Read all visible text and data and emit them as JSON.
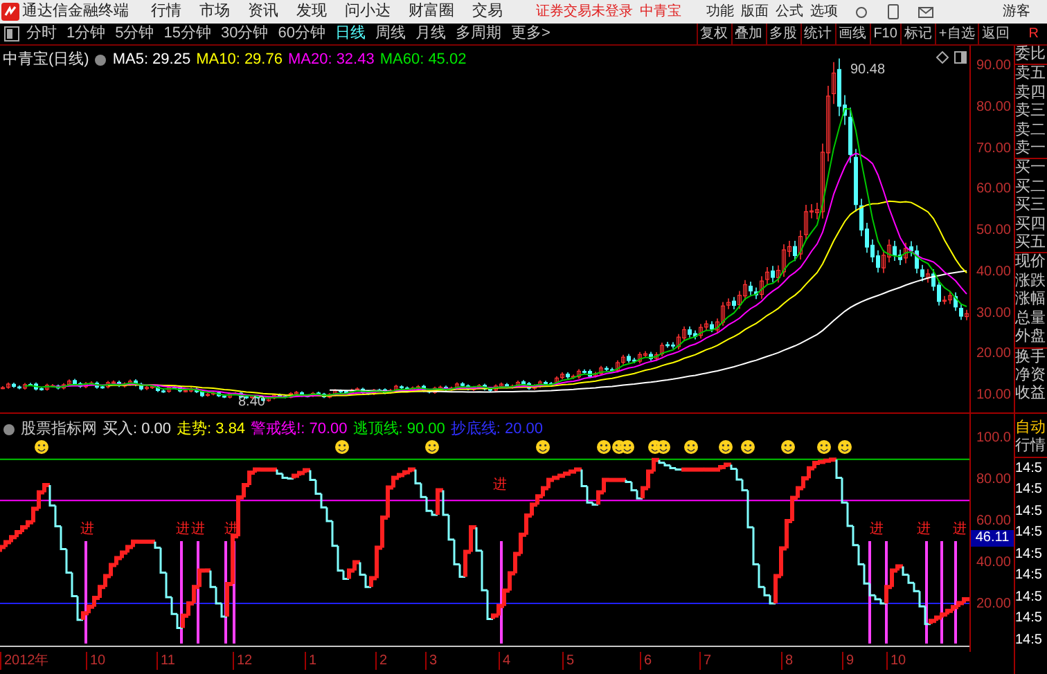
{
  "app": {
    "title": "通达信金融终端",
    "menu": [
      "行情",
      "市场",
      "资讯",
      "发现",
      "问小达",
      "财富圈",
      "交易"
    ],
    "login_status": "证券交易未登录",
    "stock_link": "中青宝",
    "right_menu": [
      "功能",
      "版面",
      "公式",
      "选项"
    ],
    "user": "游客"
  },
  "toolbar": {
    "periods": [
      {
        "label": "分时",
        "selected": false
      },
      {
        "label": "1分钟",
        "selected": false
      },
      {
        "label": "5分钟",
        "selected": false
      },
      {
        "label": "15分钟",
        "selected": false
      },
      {
        "label": "30分钟",
        "selected": false
      },
      {
        "label": "60分钟",
        "selected": false
      },
      {
        "label": "日线",
        "selected": true
      },
      {
        "label": "周线",
        "selected": false
      },
      {
        "label": "月线",
        "selected": false
      },
      {
        "label": "多周期",
        "selected": false
      },
      {
        "label": "更多>",
        "selected": false
      }
    ],
    "actions": [
      "复权",
      "叠加",
      "多股",
      "统计",
      "画线",
      "F10",
      "标记",
      "+自选",
      "返回"
    ],
    "corner": "R"
  },
  "price_chart": {
    "title": "中青宝(日线)",
    "ma_values": [
      {
        "label": "MA5: 29.25",
        "color": "#ffffff"
      },
      {
        "label": "MA10: 29.76",
        "color": "#ffff00"
      },
      {
        "label": "MA20: 32.43",
        "color": "#ff00ff"
      },
      {
        "label": "MA60: 45.02",
        "color": "#00e600"
      }
    ],
    "high_label": "90.48",
    "low_label": "8.40",
    "y_axis": [
      "90.00",
      "80.00",
      "70.00",
      "60.00",
      "50.00",
      "40.00",
      "30.00",
      "20.00",
      "10.00"
    ]
  },
  "quote_panel": {
    "groups": [
      [
        "委比"
      ],
      [
        "卖五",
        "卖四",
        "卖三",
        "卖二",
        "卖一"
      ],
      [
        "买一",
        "买二",
        "买三",
        "买四",
        "买五"
      ],
      [
        "现价",
        "涨跌",
        "涨幅",
        "总量",
        "外盘"
      ],
      [
        "换手",
        "净资",
        "收益"
      ]
    ]
  },
  "indicator": {
    "name": "股票指标网",
    "values": [
      {
        "label": "买入: 0.00",
        "color": "#e0e0e0"
      },
      {
        "label": "走势: 3.84",
        "color": "#ffff00"
      },
      {
        "label": "警戒线!: 70.00",
        "color": "#ff00ff"
      },
      {
        "label": "逃顶线: 90.00",
        "color": "#00e600"
      },
      {
        "label": "抄底线: 20.00",
        "color": "#3030ff"
      }
    ],
    "y_axis": [
      {
        "label": "100.0",
        "current": false
      },
      {
        "label": "80.00",
        "current": false
      },
      {
        "label": "60.00",
        "current": false
      },
      {
        "label": "46.11",
        "current": true
      },
      {
        "label": "40.00",
        "current": false
      },
      {
        "label": "20.00",
        "current": false
      }
    ],
    "signals": [
      "进",
      "进",
      "进",
      "进",
      "进",
      "进",
      "进",
      "进"
    ]
  },
  "tick_panel": {
    "mode": "自动",
    "title": "行情",
    "times": [
      "14:5",
      "14:5",
      "14:5",
      "14:5",
      "14:5",
      "14:5",
      "14:5",
      "14:5",
      "14:5"
    ]
  },
  "date_axis": [
    "2012年",
    "10",
    "11",
    "12",
    "1",
    "2",
    "3",
    "4",
    "5",
    "6",
    "7",
    "8",
    "9",
    "10"
  ]
}
